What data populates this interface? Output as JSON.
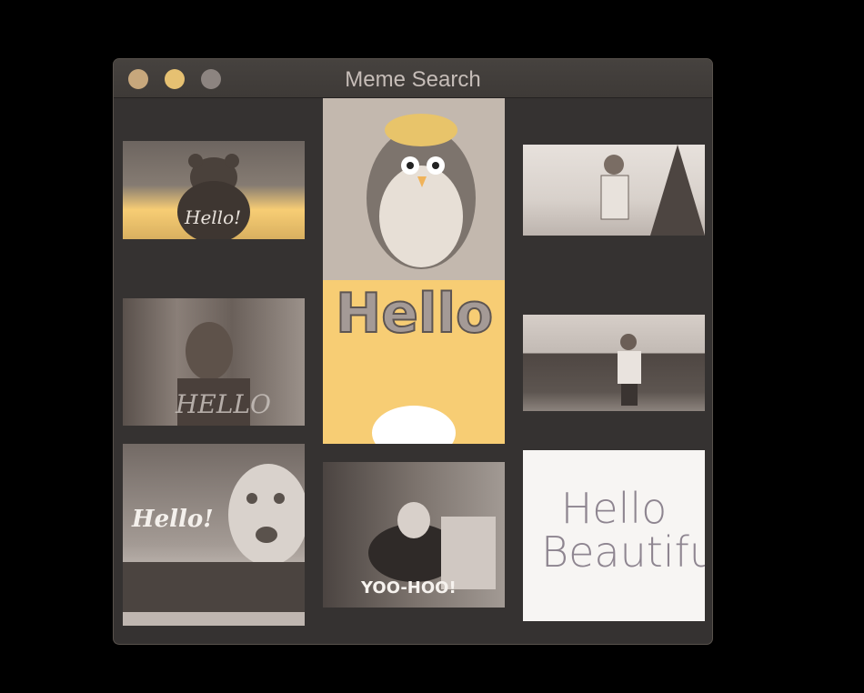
{
  "window": {
    "title": "Meme Search"
  },
  "results": [
    {
      "caption": "Hello!"
    },
    {
      "caption": "Hello"
    },
    {
      "caption": ""
    },
    {
      "caption": "HELLO"
    },
    {
      "caption": ""
    },
    {
      "caption": "Hello!"
    },
    {
      "caption": "YOO-HOO!"
    },
    {
      "caption": "Hello Beautiful"
    }
  ],
  "colors": {
    "accent": "#f7cd74",
    "window_bg": "#353231"
  }
}
